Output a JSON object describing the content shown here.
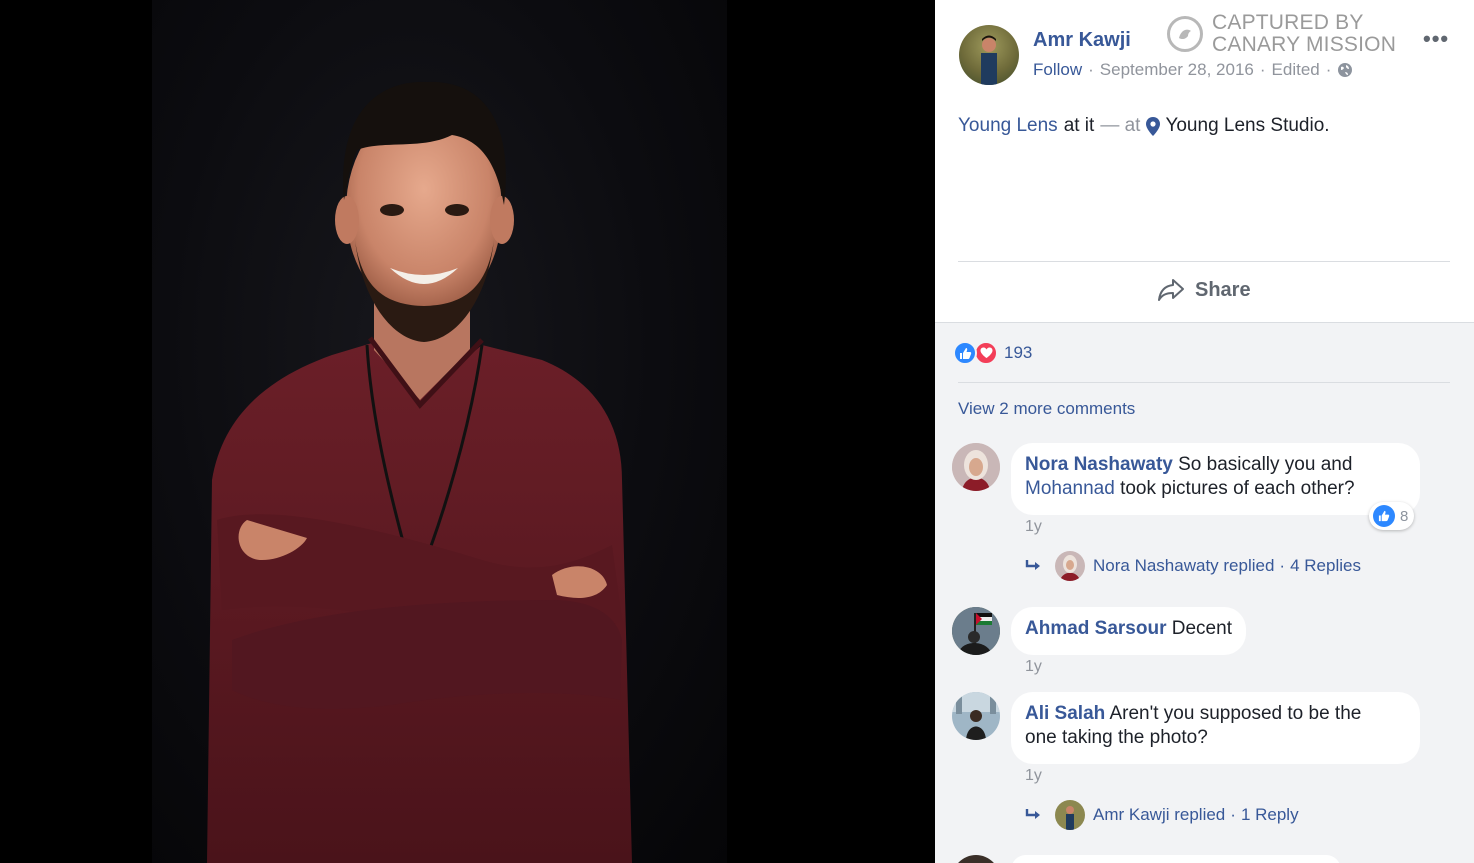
{
  "post": {
    "author": "Amr Kawji",
    "follow": "Follow",
    "date": "September 28, 2016",
    "edited": "Edited",
    "audience_icon": "globe-icon",
    "watermark_line1": "CAPTURED BY",
    "watermark_line2": "CANARY MISSION",
    "caption_page": "Young Lens",
    "caption_text": "at it",
    "caption_at": "— at",
    "caption_place": "Young Lens Studio.",
    "share_label": "Share"
  },
  "reactions": {
    "count": "193",
    "types": [
      "like-icon",
      "love-icon"
    ]
  },
  "comments": {
    "view_more": "View 2 more comments",
    "items": [
      {
        "name": "Nora Nashawaty",
        "text_before": "So basically you and",
        "mention": "Mohannad",
        "text_after": "took pictures of each other?",
        "time": "1y",
        "likes": "8",
        "reply_text": "Nora Nashawaty replied",
        "reply_count": "4 Replies"
      },
      {
        "name": "Ahmad Sarsour",
        "text": "Decent",
        "time": "1y"
      },
      {
        "name": "Ali Salah",
        "text_line1": "Aren't you supposed to be the",
        "text_line2": "one taking the photo?",
        "time": "1y",
        "reply_text": "Amr Kawji replied",
        "reply_count": "1 Reply"
      }
    ]
  },
  "colors": {
    "link": "#385898",
    "muted": "#90949c",
    "shirt": "#5e1a22",
    "panel_bg": "#f2f3f5"
  }
}
